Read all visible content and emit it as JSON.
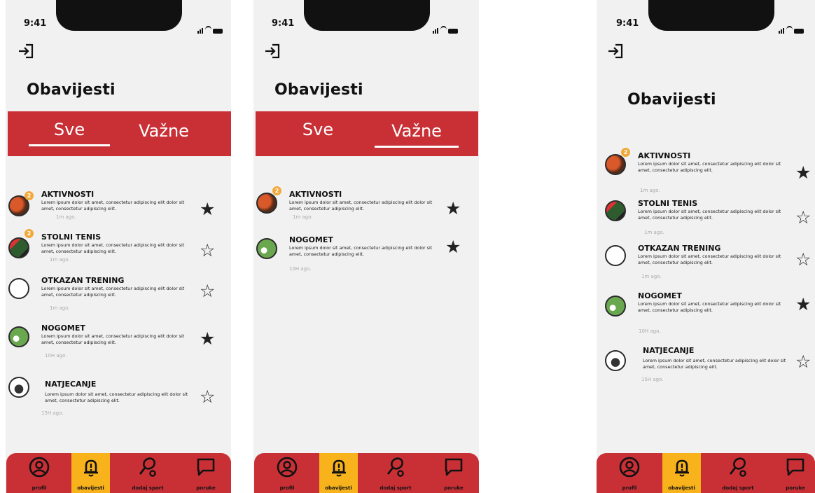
{
  "status": {
    "time": "9:41"
  },
  "title": "Obavijesti",
  "tabs": {
    "all": "Sve",
    "important": "Važne"
  },
  "notifications": [
    {
      "title": "AKTIVNOSTI",
      "body": "Lorem ipsum dolor sit amet, consectetur adipiscing elit dolor sit amet, consectetur adipiscing elit.",
      "time": "1m ago.",
      "badge": "2"
    },
    {
      "title": "STOLNI TENIS",
      "body": "Lorem ipsum dolor sit amet, consectetur adipiscing elit dolor sit amet, consectetur adipiscing elit.",
      "time": "1m ago.",
      "badge": "2"
    },
    {
      "title": "OTKAZAN TRENING",
      "body": "Lorem ipsum dolor sit amet, consectetur adipiscing elit dolor sit amet, consectetur adipiscing elit.",
      "time": "1m ago."
    },
    {
      "title": "NOGOMET",
      "body": "Lorem ipsum dolor sit amet, consectetur adipiscing elit dolor sit amet, consectetur adipiscing elit.",
      "time": "10H ago."
    },
    {
      "title": "NATJECANJE",
      "body": "Lorem ipsum dolor sit amet, consectetur adipiscing elit dolor sit amet, consectetur adipiscing elit.",
      "time": "15H ago."
    }
  ],
  "stars": {
    "filled": "★",
    "empty": "☆"
  },
  "nav": {
    "profile": "profil",
    "notifications": "obavijesti",
    "add_sport": "dodaj sport",
    "messages": "poruke"
  },
  "colors": {
    "brand_red": "#c93036",
    "active_yellow": "#f7b21c",
    "badge_orange": "#f2a93b"
  }
}
